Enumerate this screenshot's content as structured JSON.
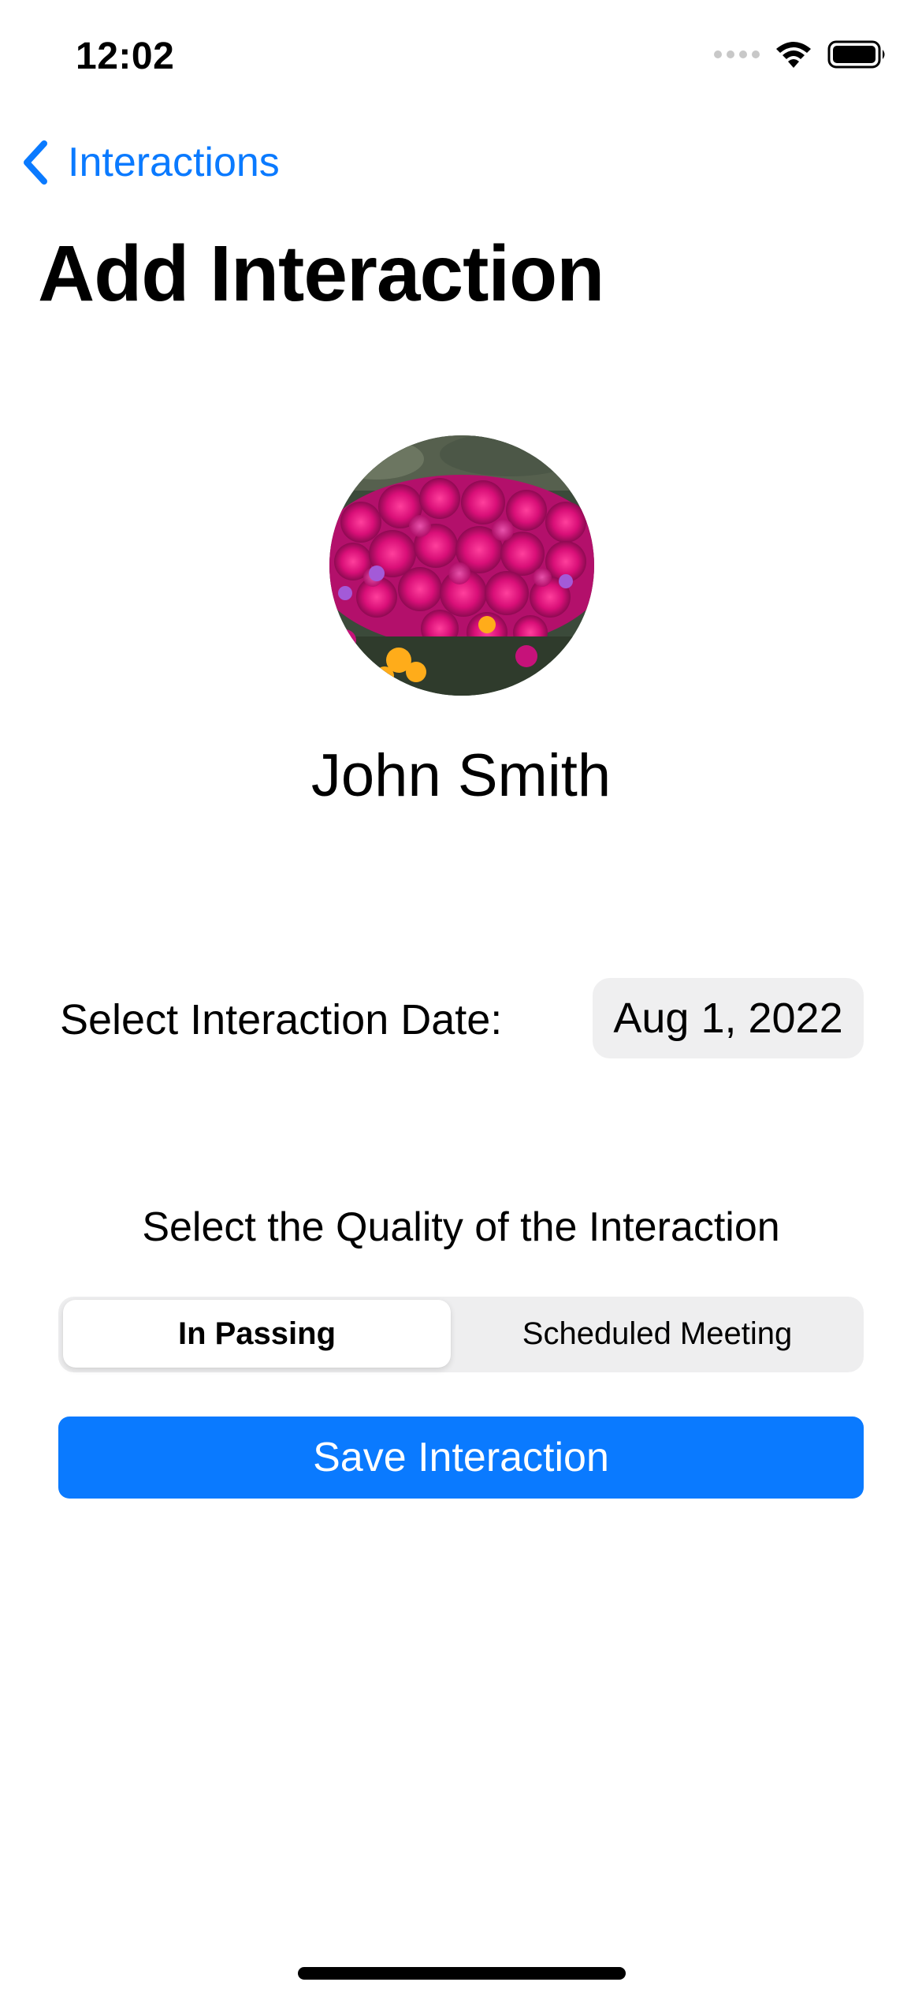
{
  "status_bar": {
    "time": "12:02"
  },
  "nav": {
    "back_label": "Interactions",
    "title": "Add Interaction"
  },
  "contact": {
    "name": "John Smith"
  },
  "date_row": {
    "label": "Select Interaction Date:",
    "value": "Aug 1, 2022"
  },
  "quality": {
    "label": "Select the Quality of the Interaction",
    "options": [
      "In Passing",
      "Scheduled Meeting"
    ],
    "selected": "In Passing"
  },
  "actions": {
    "save_label": "Save Interaction"
  },
  "colors": {
    "accent": "#0a7aff",
    "control_bg": "#eeeeef"
  }
}
